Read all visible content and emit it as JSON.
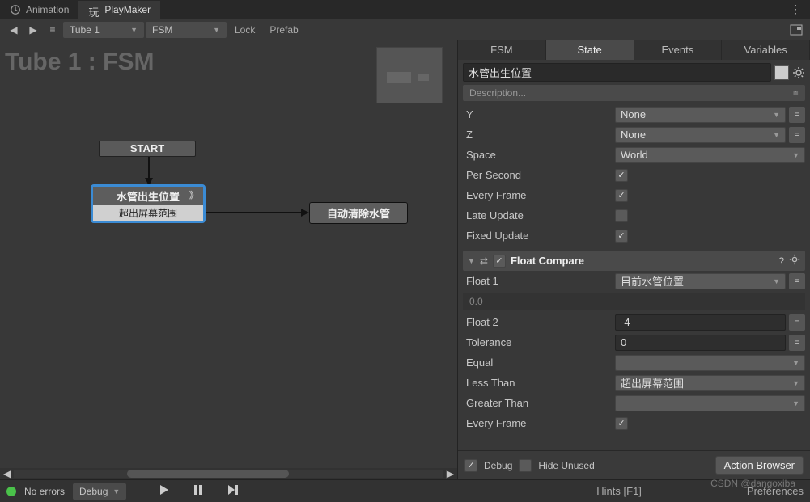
{
  "tabs": {
    "animation": "Animation",
    "playmaker": "PlayMaker"
  },
  "toolbar": {
    "object_dd": "Tube 1",
    "fsm_dd": "FSM",
    "lock": "Lock",
    "prefab": "Prefab"
  },
  "canvas": {
    "title": "Tube 1 : FSM",
    "start": "START",
    "state1_name": "水管出生位置",
    "state1_event": "超出屏幕范围",
    "state2_name": "自动清除水管"
  },
  "inspector": {
    "tabs": {
      "fsm": "FSM",
      "state": "State",
      "events": "Events",
      "variables": "Variables"
    },
    "state_name": "水管出生位置",
    "description_ph": "Description...",
    "props": {
      "y": "Y",
      "y_val": "None",
      "z": "Z",
      "z_val": "None",
      "space": "Space",
      "space_val": "World",
      "per_second": "Per Second",
      "every_frame": "Every Frame",
      "late_update": "Late Update",
      "fixed_update": "Fixed Update"
    },
    "action2": {
      "title": "Float Compare",
      "float1": "Float 1",
      "float1_val": "目前水管位置",
      "disabled_val": "0.0",
      "float2": "Float 2",
      "float2_val": "-4",
      "tolerance": "Tolerance",
      "tolerance_val": "0",
      "equal": "Equal",
      "less_than": "Less Than",
      "less_than_val": "超出屏幕范围",
      "greater_than": "Greater Than",
      "every_frame": "Every Frame"
    },
    "footer": {
      "debug": "Debug",
      "hide_unused": "Hide Unused",
      "action_browser": "Action Browser"
    }
  },
  "status": {
    "no_errors": "No errors",
    "debug": "Debug",
    "hints": "Hints [F1]",
    "preferences": "Preferences"
  },
  "watermark": "CSDN @dangoxiba"
}
